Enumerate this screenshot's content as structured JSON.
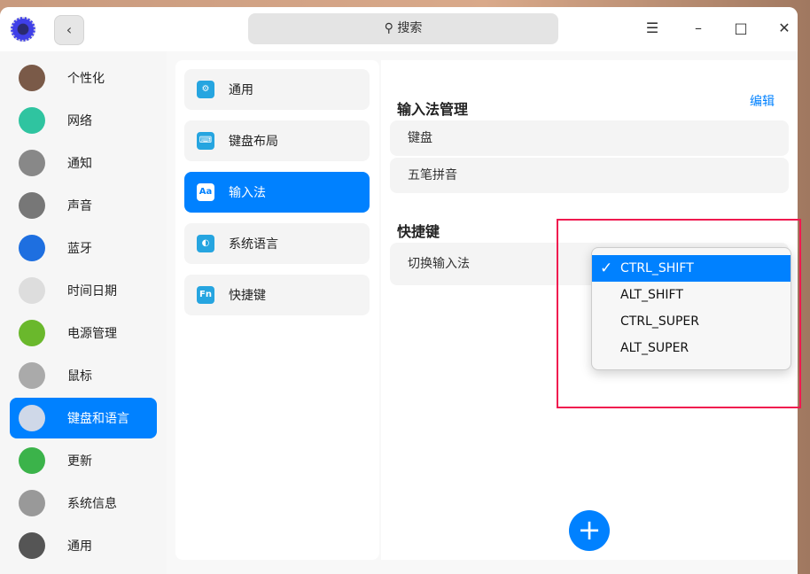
{
  "titlebar": {
    "search_placeholder": "搜索",
    "back_icon": "‹",
    "menu_icon": "☰",
    "minimize_icon": "–",
    "maximize_icon": "□",
    "close_icon": "✕"
  },
  "sidebar": {
    "items": [
      {
        "label": "个性化",
        "color": "#7a5a48"
      },
      {
        "label": "网络",
        "color": "#2fc4a0"
      },
      {
        "label": "通知",
        "color": "#888"
      },
      {
        "label": "声音",
        "color": "#777"
      },
      {
        "label": "蓝牙",
        "color": "#1e6fe0"
      },
      {
        "label": "时间日期",
        "color": "#ddd"
      },
      {
        "label": "电源管理",
        "color": "#6ab82c"
      },
      {
        "label": "鼠标",
        "color": "#aaa"
      },
      {
        "label": "键盘和语言",
        "color": "#cfd8e8"
      },
      {
        "label": "更新",
        "color": "#3bb34a"
      },
      {
        "label": "系统信息",
        "color": "#999"
      },
      {
        "label": "通用",
        "color": "#555"
      }
    ],
    "active_index": 8
  },
  "middle": {
    "items": [
      {
        "label": "通用",
        "icon": "⚙"
      },
      {
        "label": "键盘布局",
        "icon": "⌨"
      },
      {
        "label": "输入法",
        "icon": "Aa"
      },
      {
        "label": "系统语言",
        "icon": "◐"
      },
      {
        "label": "快捷键",
        "icon": "Fn"
      }
    ],
    "active_index": 2
  },
  "right": {
    "im_title": "输入法管理",
    "edit": "编辑",
    "im_list": [
      "键盘",
      "五笔拼音"
    ],
    "shortcut_title": "快捷键",
    "switch_label": "切换输入法",
    "add_icon": "+"
  },
  "dropdown": {
    "options": [
      "CTRL_SHIFT",
      "ALT_SHIFT",
      "CTRL_SUPER",
      "ALT_SUPER"
    ],
    "selected": "CTRL_SHIFT",
    "check_icon": "✓"
  }
}
